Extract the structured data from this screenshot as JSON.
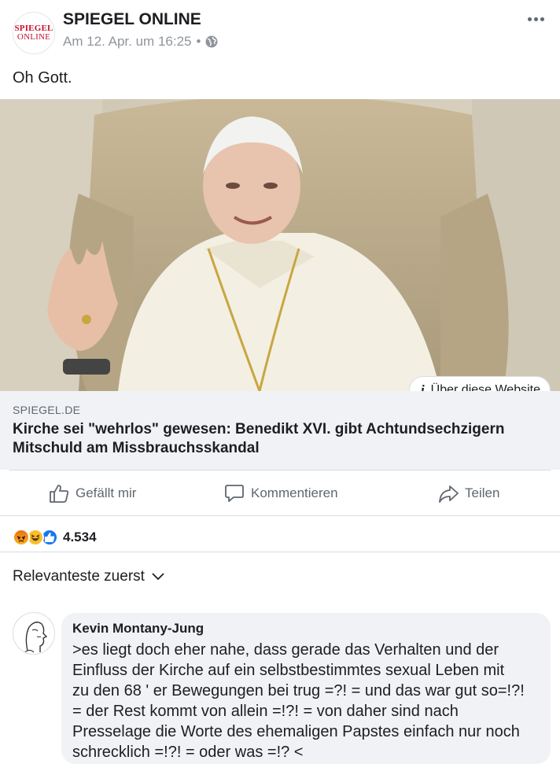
{
  "post": {
    "page_name": "SPIEGEL ONLINE",
    "avatar_line1": "SPIEGEL",
    "avatar_line2": "ONLINE",
    "timestamp": "Am 12. Apr. um 16:25",
    "separator": "•",
    "privacy_icon": "globe-icon",
    "text": "Oh Gott."
  },
  "link": {
    "about_label": "Über diese Website",
    "info_glyph": "i",
    "domain": "SPIEGEL.DE",
    "title": "Kirche sei \"wehrlos\" gewesen: Benedikt XVI. gibt Achtundsechzigern Mitschuld am Missbrauchsskandal"
  },
  "actions": {
    "like": "Gefällt mir",
    "comment": "Kommentieren",
    "share": "Teilen"
  },
  "reactions": {
    "icons": [
      "angry-icon",
      "haha-icon",
      "like-icon"
    ],
    "count": "4.534"
  },
  "comments": {
    "sort_label": "Relevanteste zuerst",
    "items": [
      {
        "author": "Kevin Montany-Jung",
        "text": ">es liegt doch eher nahe, dass gerade  das Verhalten und der\nEinfluss der Kirche auf ein selbstbestimmtes sexual Leben mit\nzu den 68 ' er Bewegungen bei trug =?! = und das war gut so=!?!\n= der Rest kommt von allein =!?! = von daher sind nach\nPresselage die Worte des ehemaligen Papstes einfach nur noch\nschrecklich =!?! = oder was =!? <"
      }
    ]
  },
  "colors": {
    "brand_red": "#c8102e",
    "like_blue": "#1877f2",
    "meta_gray": "#90949c",
    "caption_bg": "#f0f2f5"
  }
}
